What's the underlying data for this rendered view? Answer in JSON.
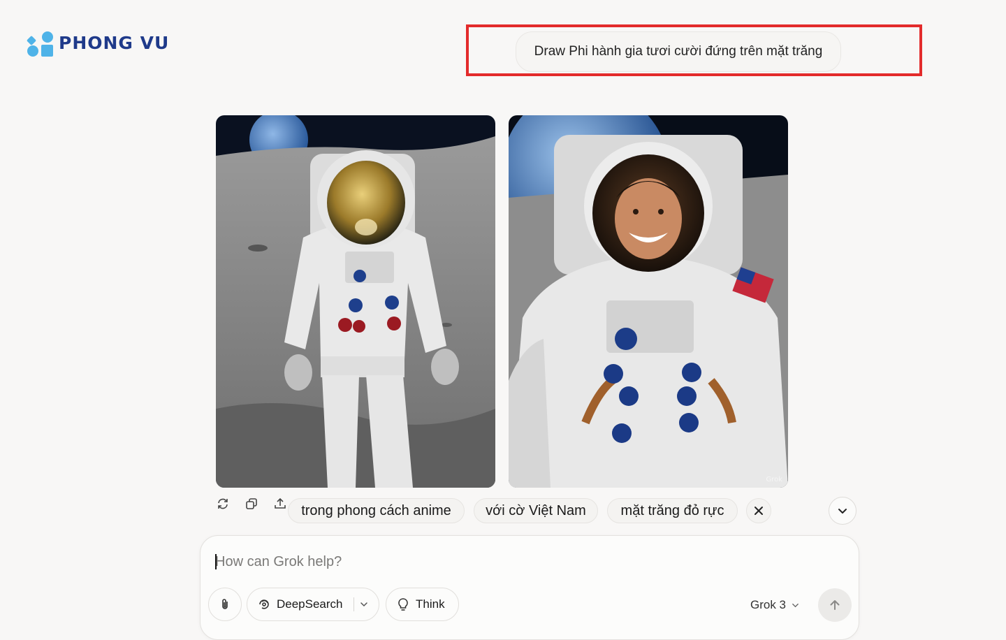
{
  "brand": {
    "name": "PHONG VU",
    "color": "#1f3a8a",
    "accent": "#4fb3e8"
  },
  "prompt": {
    "text": "Draw Phi hành gia tươi cười đứng trên mặt trăng"
  },
  "highlight_color": "#e32b2b",
  "images": [
    {
      "name": "astronaut-full-body-image",
      "alt": "Astronaut standing on the moon with gold visor"
    },
    {
      "name": "astronaut-smiling-image",
      "alt": "Smiling astronaut close-up on the moon"
    }
  ],
  "actions": [
    {
      "name": "regenerate-icon"
    },
    {
      "name": "copy-icon"
    },
    {
      "name": "share-icon"
    }
  ],
  "suggestions": [
    "trong phong cách anime",
    "với cờ Việt Nam",
    "mặt trăng đỏ rực"
  ],
  "composer": {
    "placeholder": "How can Grok help?",
    "deepsearch_label": "DeepSearch",
    "think_label": "Think",
    "model": "Grok 3"
  }
}
